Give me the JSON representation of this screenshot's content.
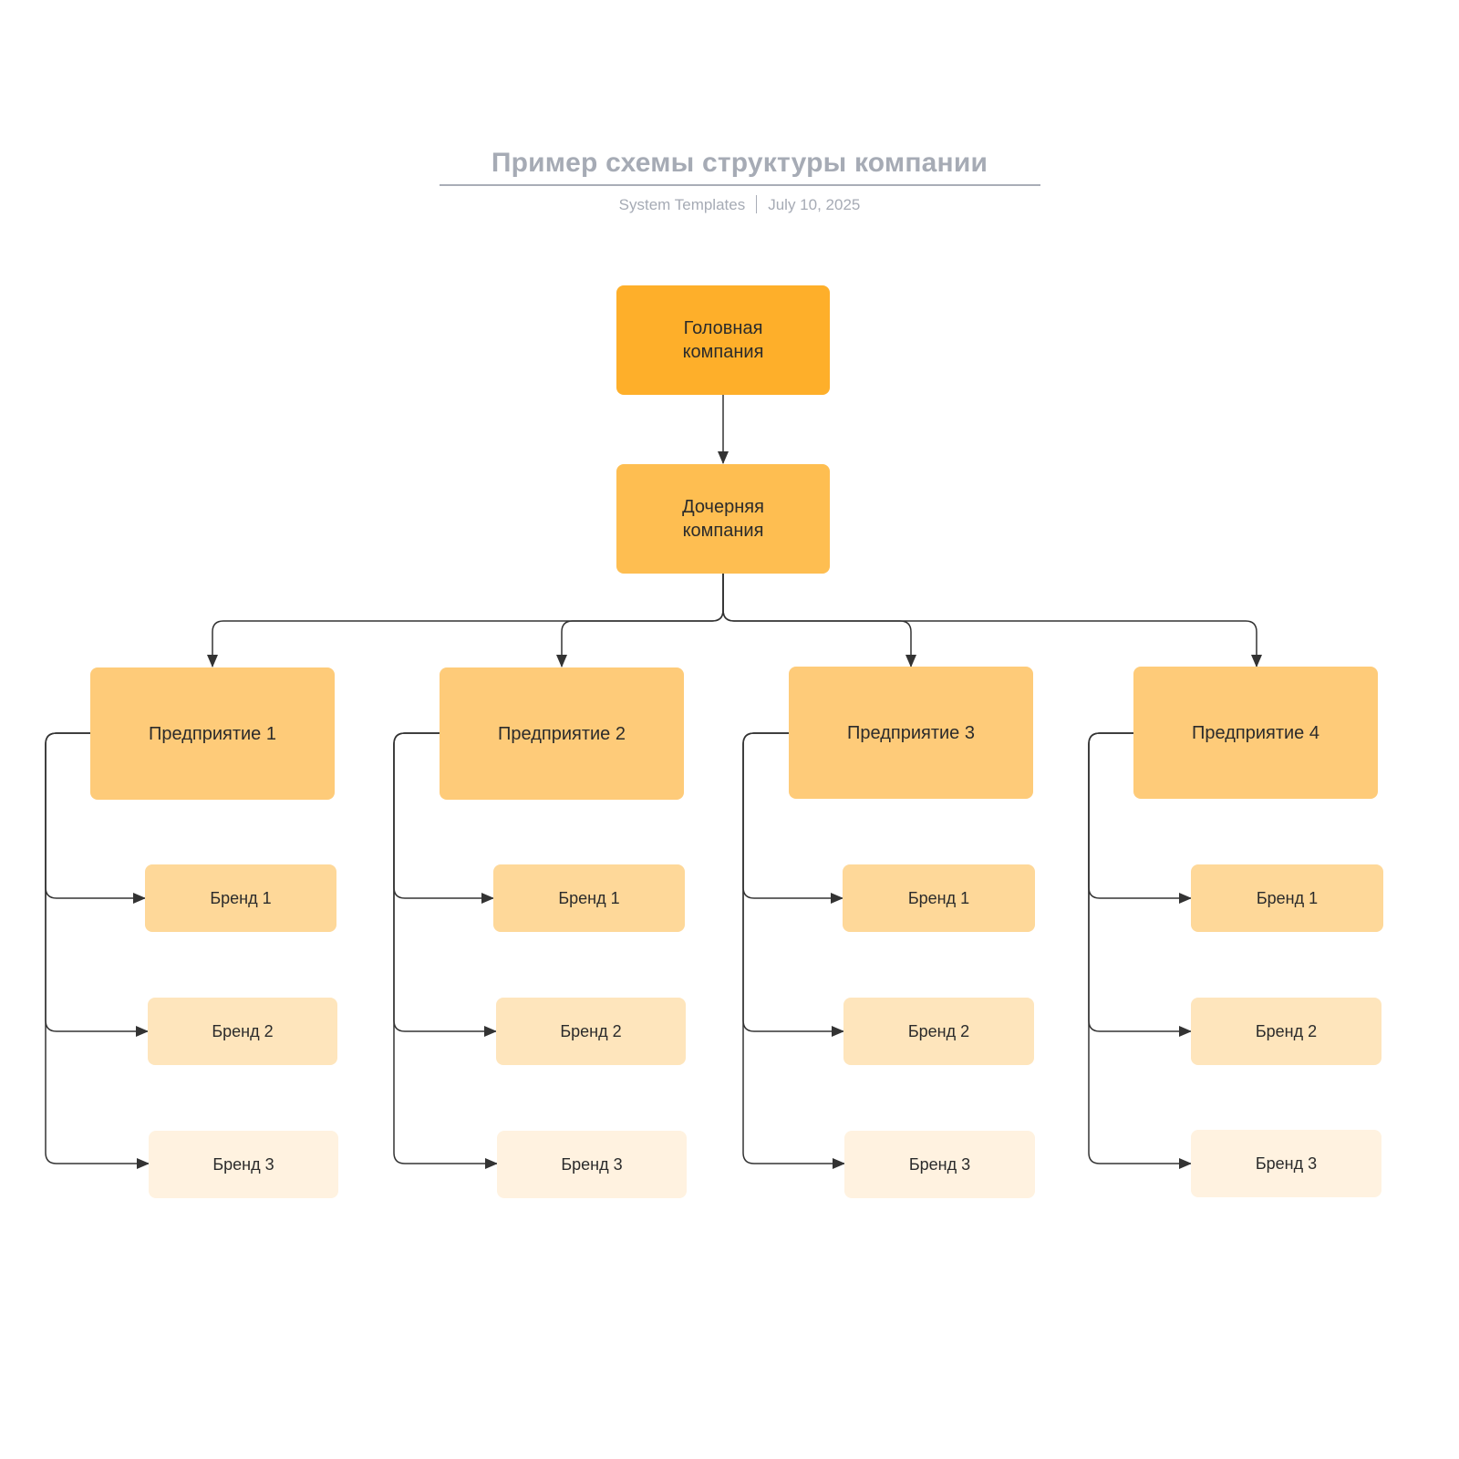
{
  "header": {
    "title": "Пример схемы структуры компании",
    "author": "System Templates",
    "date": "July 10, 2025"
  },
  "colors": {
    "head": "#feaf2a",
    "subsidiary": "#febe51",
    "enterprise": "#fecb79",
    "brand1": "#fed899",
    "brand2": "#fee5bc",
    "brand3": "#fff2e0",
    "connector": "#333333"
  },
  "diagram": {
    "head": {
      "label": "Головная\nкомпания"
    },
    "subsidiary": {
      "label": "Дочерняя\nкомпания"
    },
    "enterprises": [
      {
        "label": "Предприятие 1",
        "brands": [
          "Бренд 1",
          "Бренд 2",
          "Бренд 3"
        ]
      },
      {
        "label": "Предприятие 2",
        "brands": [
          "Бренд 1",
          "Бренд 2",
          "Бренд 3"
        ]
      },
      {
        "label": "Предприятие 3",
        "brands": [
          "Бренд 1",
          "Бренд 2",
          "Бренд 3"
        ]
      },
      {
        "label": "Предприятие 4",
        "brands": [
          "Бренд 1",
          "Бренд 2",
          "Бренд 3"
        ]
      }
    ]
  }
}
